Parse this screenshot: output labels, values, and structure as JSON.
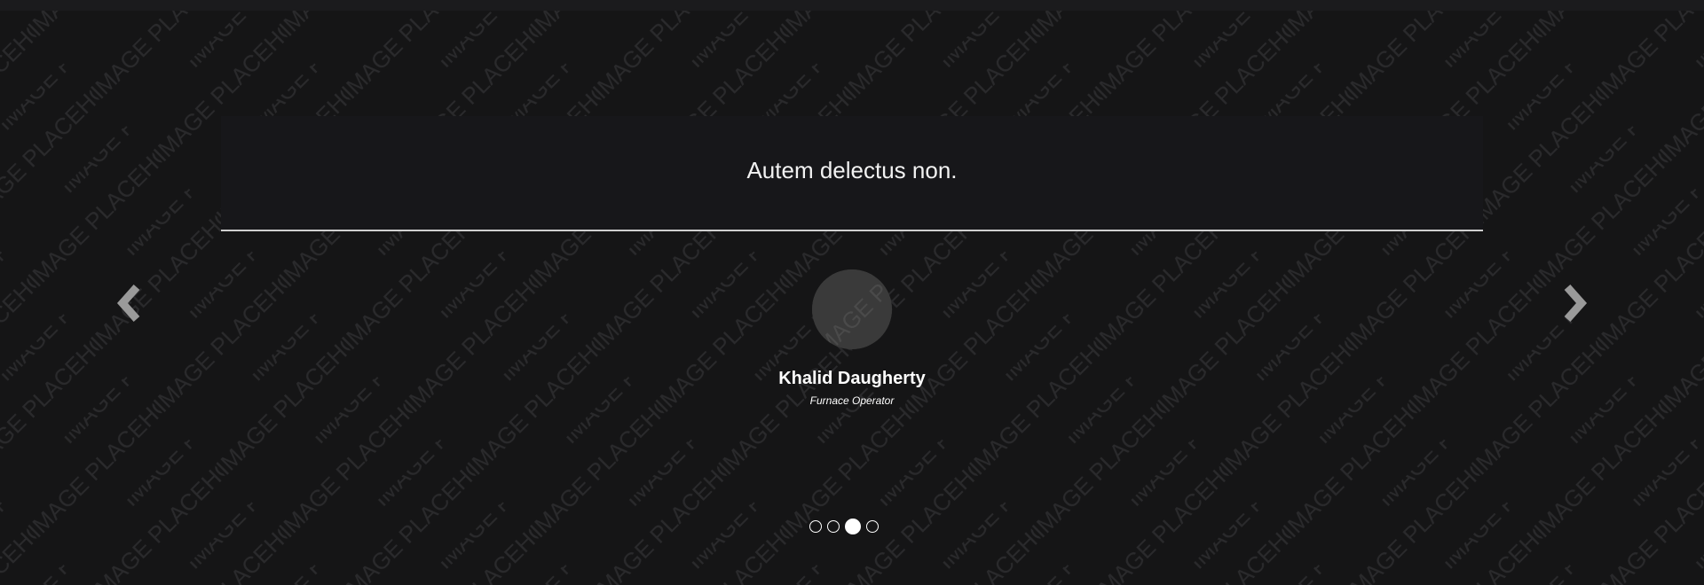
{
  "background": {
    "watermark_text": "IMAGE PLACEHOLDER",
    "color": "#151516",
    "watermark_color": "#2a2a2c"
  },
  "testimonial": {
    "quote": "Autem delectus non.",
    "name": "Khalid Daugherty",
    "role": "Furnace Operator",
    "divider_color": "#cfcfcf"
  },
  "avatar": {
    "watermark_text": "IMAGE PLACEHOLDER",
    "color": "#3a3a3a"
  },
  "navigation": {
    "prev_icon": "chevron-left-icon",
    "next_icon": "chevron-right-icon",
    "arrow_color": "#9a9a9a"
  },
  "pagination": {
    "total": 4,
    "active_index": 2
  }
}
